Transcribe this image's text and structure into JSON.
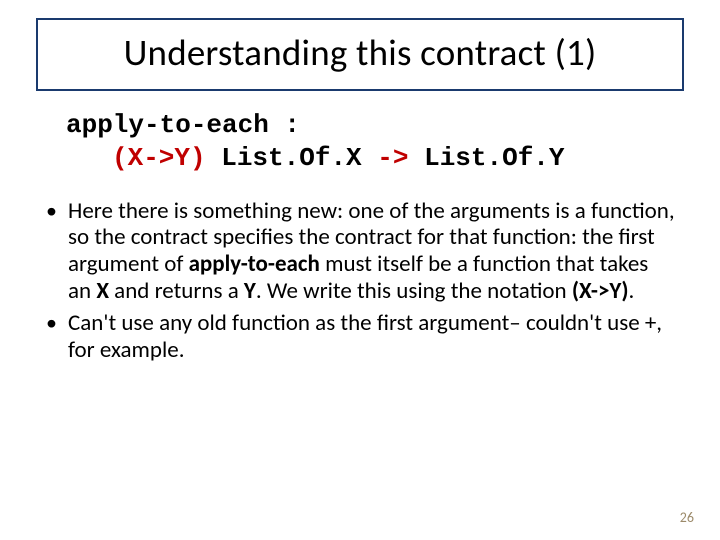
{
  "title": "Understanding this contract (1)",
  "code": {
    "line1": "apply-to-each :",
    "line2_red": "(X->Y)",
    "line2_black_a": " List.Of.X ",
    "line2_red_arrow": "->",
    "line2_black_b": " List.Of.Y"
  },
  "bullets": {
    "b1_a": "Here there is something new: one of the arguments is a function, so the contract specifies the contract for that function: the first argument of ",
    "b1_b": "apply-to-each",
    "b1_c": " must itself be a function that takes an ",
    "b1_d": "X",
    "b1_e": " and returns a ",
    "b1_f": "Y",
    "b1_g": ".  We write this using the notation ",
    "b1_h": "(X->Y)",
    "b1_i": ".",
    "b2": "Can't use any old function as the first argument– couldn't use +, for example."
  },
  "page_number": "26"
}
